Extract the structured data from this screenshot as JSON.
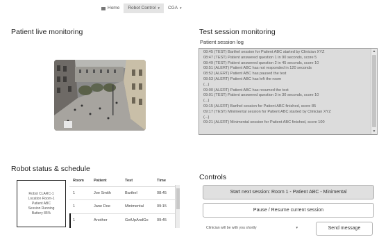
{
  "navbar": {
    "items": [
      {
        "label": "Home",
        "icon": "home-icon",
        "active": false
      },
      {
        "label": "Robot Control",
        "icon": "caret-down-icon",
        "active": true
      },
      {
        "label": "CGA",
        "icon": "caret-down-icon",
        "active": false
      }
    ]
  },
  "live": {
    "title": "Patient live monitoring"
  },
  "session": {
    "title": "Test session monitoring",
    "log_label": "Patient session log",
    "log_lines": [
      "08:45 (TEST) Barthel session for Patient ABC started by Clinician XYZ",
      "08:47 (TEST) Patient answered question 1 in 90 seconds, score 5",
      "08:49 (TEST) Patient answered question 2 in 45 seconds, score 10",
      "08:51 (ALERT) Patient ABC has not responded in 120 seconds",
      "08:52 (ALERT) Patient ABC has paused the test",
      "08:53 (ALERT) Patient ABC has left the room",
      "(...)",
      "09:00 (ALERT) Patient ABC has resumed the test",
      "09:01 (TEST) Patient answered question 3 in 30 seconds, score 10",
      "(...)",
      "09:15 (ALERT) Barthel session for Patient ABC finished, score 85",
      "09:17 (TEST) Minimental session for Patient ABC started by Clinician XYZ",
      "(...)",
      "09:21 (ALERT) Minimental session for Patient ABC finished, score 100"
    ]
  },
  "robot": {
    "title": "Robot status & schedule",
    "info_lines": [
      "Robot CLARC-1",
      "Location Room-1",
      "Patient ABC",
      "Session Running",
      "Battery 85%"
    ]
  },
  "schedule": {
    "columns": [
      "Room",
      "Patient",
      "Test",
      "Time"
    ],
    "rows": [
      {
        "room": "1",
        "patient": "Joe Smith",
        "test": "Barthel",
        "time": "08:45"
      },
      {
        "room": "1",
        "patient": "Jane Doe",
        "test": "Minimental",
        "time": "09:15"
      },
      {
        "room": "1",
        "patient": "Another",
        "test": "GetUpAndGo",
        "time": "09:45"
      }
    ]
  },
  "controls": {
    "title": "Controls",
    "start_label": "Start next session: Room 1 - Patient ABC - Minimental",
    "pause_label": "Pause / Resume current session",
    "message_value": "Clinician will be with you shortly",
    "send_label": "Send message"
  },
  "colors": {
    "log_background": "#dcdcdc",
    "active_nav": "#e4e4e4",
    "primary_button": "#e0e0e0"
  }
}
